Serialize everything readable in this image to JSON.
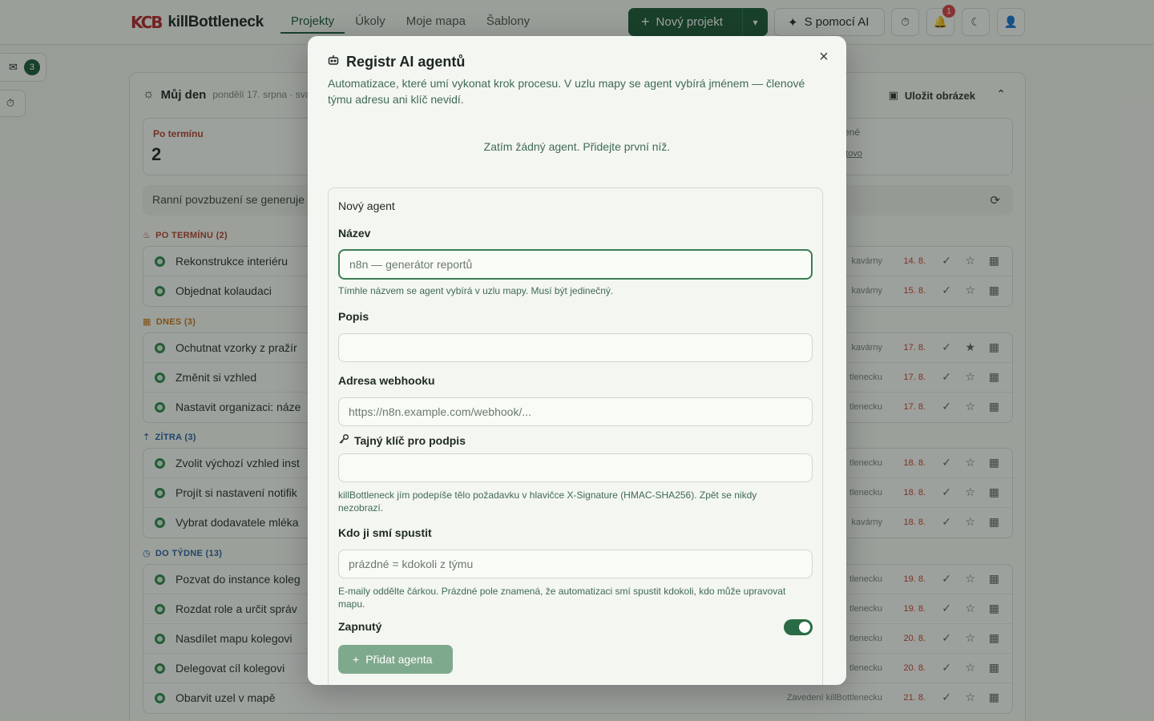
{
  "header": {
    "logo_mark": "KCB",
    "app_name": "killBottleneck",
    "nav": [
      "Projekty",
      "Úkoly",
      "Moje mapa",
      "Šablony"
    ],
    "new_project": "Nový projekt",
    "ai_button": "S pomocí AI",
    "notif_count": "1"
  },
  "rail": {
    "inbox_count": "3"
  },
  "main": {
    "title": "Můj den",
    "date": "pondělí 17. srpna · sva",
    "save_image": "Uložit obrázek",
    "overdue_label": "Po termínu",
    "overdue_count": "2",
    "done_label": "řené",
    "done_link": "otovo",
    "motivation": "Ranní povzbuzení se generuje",
    "sections": [
      {
        "label": "PO TERMÍNU (2)",
        "tasks": [
          {
            "title": "Rekonstrukce interiéru",
            "project": "kavárny",
            "due": "14. 8."
          },
          {
            "title": "Objednat kolaudaci",
            "project": "kavárny",
            "due": "15. 8."
          }
        ]
      },
      {
        "label": "DNES (3)",
        "tasks": [
          {
            "title": "Ochutnat vzorky z pražír",
            "project": "kavárny",
            "due": "17. 8."
          },
          {
            "title": "Změnit si vzhled",
            "project": "tlenecku",
            "due": "17. 8."
          },
          {
            "title": "Nastavit organizaci: náze",
            "project": "tlenecku",
            "due": "17. 8."
          }
        ]
      },
      {
        "label": "ZÍTRA (3)",
        "tasks": [
          {
            "title": "Zvolit výchozí vzhled inst",
            "project": "tlenecku",
            "due": "18. 8."
          },
          {
            "title": "Projít si nastavení notifik",
            "project": "tlenecku",
            "due": "18. 8."
          },
          {
            "title": "Vybrat dodavatele mléka",
            "project": "kavárny",
            "due": "18. 8."
          }
        ]
      },
      {
        "label": "DO TÝDNE (13)",
        "tasks": [
          {
            "title": "Pozvat do instance koleg",
            "project": "tlenecku",
            "due": "19. 8."
          },
          {
            "title": "Rozdat role a určit správ",
            "project": "tlenecku",
            "due": "19. 8."
          },
          {
            "title": "Nasdílet mapu kolegovi",
            "project": "tlenecku",
            "due": "20. 8."
          },
          {
            "title": "Delegovat cíl kolegovi",
            "project": "tlenecku",
            "due": "20. 8."
          },
          {
            "title": "Obarvit uzel v mapě",
            "project": "Zavedení killBottlenecku",
            "due": "21. 8."
          }
        ]
      }
    ]
  },
  "modal": {
    "title": "Registr AI agentů",
    "description": "Automatizace, které umí vykonat krok procesu. V uzlu mapy se agent vybírá jménem — členové týmu adresu ani klíč nevidí.",
    "empty_state": "Zatím žádný agent. Přidejte první níž.",
    "form": {
      "heading": "Nový agent",
      "name_label": "Název",
      "name_placeholder": "n8n — generátor reportů",
      "name_hint": "Tímhle názvem se agent vybírá v uzlu mapy. Musí být jedinečný.",
      "desc_label": "Popis",
      "desc_value": "",
      "webhook_label": "Adresa webhooku",
      "webhook_placeholder": "https://n8n.example.com/webhook/...",
      "secret_label": "Tajný klíč pro podpis",
      "secret_value": "",
      "secret_hint": "killBottleneck jím podepíše tělo požadavku v hlavičce X-Signature (HMAC-SHA256). Zpět se nikdy nezobrazí.",
      "who_label": "Kdo ji smí spustit",
      "who_placeholder": "prázdné = kdokoli z týmu",
      "who_hint": "E-maily oddělte čárkou. Prázdné pole znamená, že automatizaci smí spustit kdokoli, kdo může upravovat mapu.",
      "enabled_label": "Zapnutý",
      "enabled": true,
      "submit": "Přidat agenta"
    }
  }
}
